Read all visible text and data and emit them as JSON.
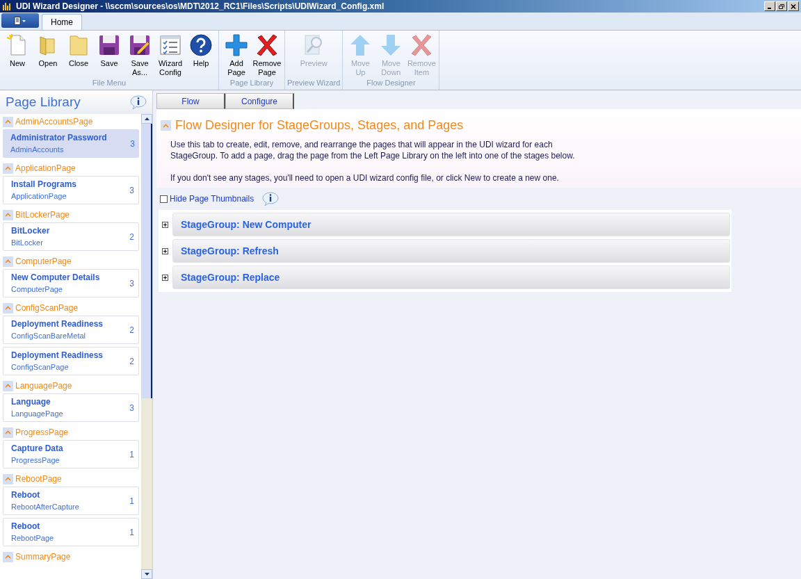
{
  "window": {
    "title": "UDI Wizard Designer - \\\\sccm\\sources\\os\\MDT\\2012_RC1\\Files\\Scripts\\UDIWizard_Config.xml"
  },
  "ribbon": {
    "tabs": [
      {
        "label": "Home",
        "selected": true
      }
    ],
    "groups": [
      {
        "label": "File Menu",
        "buttons": [
          {
            "kind": "new",
            "lines": [
              "New"
            ],
            "disabled": false
          },
          {
            "kind": "open",
            "lines": [
              "Open"
            ],
            "disabled": false
          },
          {
            "kind": "close",
            "lines": [
              "Close"
            ],
            "disabled": false
          },
          {
            "kind": "save",
            "lines": [
              "Save"
            ],
            "disabled": false
          },
          {
            "kind": "saveas",
            "lines": [
              "Save",
              "As..."
            ],
            "disabled": false
          },
          {
            "kind": "config",
            "lines": [
              "Wizard",
              "Config"
            ],
            "disabled": false
          },
          {
            "kind": "help",
            "lines": [
              "Help"
            ],
            "disabled": false
          }
        ]
      },
      {
        "label": "Page Library",
        "buttons": [
          {
            "kind": "add",
            "lines": [
              "Add",
              "Page"
            ],
            "disabled": false
          },
          {
            "kind": "remove",
            "lines": [
              "Remove",
              "Page"
            ],
            "disabled": false
          }
        ]
      },
      {
        "label": "Preview Wizard",
        "buttons": [
          {
            "kind": "preview",
            "lines": [
              "Preview"
            ],
            "disabled": true
          }
        ]
      },
      {
        "label": "Flow Designer",
        "buttons": [
          {
            "kind": "up",
            "lines": [
              "Move",
              "Up"
            ],
            "disabled": true
          },
          {
            "kind": "down",
            "lines": [
              "Move",
              "Down"
            ],
            "disabled": true
          },
          {
            "kind": "remove",
            "lines": [
              "Remove",
              "Item"
            ],
            "disabled": true
          }
        ]
      }
    ]
  },
  "sidebar": {
    "title": "Page Library",
    "groups": [
      {
        "name": "AdminAccountsPage",
        "expanded": true,
        "items": [
          {
            "title": "Administrator Password",
            "subtitle": "AdminAccounts",
            "count": "3",
            "selected": true
          }
        ]
      },
      {
        "name": "ApplicationPage",
        "expanded": true,
        "items": [
          {
            "title": "Install Programs",
            "subtitle": "ApplicationPage",
            "count": "3",
            "selected": false
          }
        ]
      },
      {
        "name": "BitLockerPage",
        "expanded": true,
        "items": [
          {
            "title": "BitLocker",
            "subtitle": "BitLocker",
            "count": "2",
            "selected": false
          }
        ]
      },
      {
        "name": "ComputerPage",
        "expanded": true,
        "items": [
          {
            "title": "New Computer Details",
            "subtitle": "ComputerPage",
            "count": "3",
            "selected": false
          }
        ]
      },
      {
        "name": "ConfigScanPage",
        "expanded": true,
        "items": [
          {
            "title": "Deployment Readiness",
            "subtitle": "ConfigScanBareMetal",
            "count": "2",
            "selected": false
          },
          {
            "title": "Deployment Readiness",
            "subtitle": "ConfigScanPage",
            "count": "2",
            "selected": false
          }
        ]
      },
      {
        "name": "LanguagePage",
        "expanded": true,
        "items": [
          {
            "title": "Language",
            "subtitle": "LanguagePage",
            "count": "3",
            "selected": false
          }
        ]
      },
      {
        "name": "ProgressPage",
        "expanded": true,
        "items": [
          {
            "title": "Capture Data",
            "subtitle": "ProgressPage",
            "count": "1",
            "selected": false
          }
        ]
      },
      {
        "name": "RebootPage",
        "expanded": true,
        "items": [
          {
            "title": "Reboot",
            "subtitle": "RebootAfterCapture",
            "count": "1",
            "selected": false
          },
          {
            "title": "Reboot",
            "subtitle": "RebootPage",
            "count": "1",
            "selected": false
          }
        ]
      },
      {
        "name": "SummaryPage",
        "expanded": true
      }
    ]
  },
  "main": {
    "tabs": [
      {
        "label": "Flow"
      },
      {
        "label": "Configure"
      }
    ],
    "section": {
      "title": "Flow Designer for StageGroups, Stages, and Pages",
      "expanded": true,
      "paragraphs": [
        "Use this tab to create, edit, remove, and rearrange the pages that will appear in the UDI wizard for each StageGroup. To add a page, drag the page from the Left Page Library on the left into one of the stages below.",
        "If you don't see any stages, you'll need to open a UDI wizard config file, or click New to create a new one."
      ]
    },
    "hide_thumbnails": {
      "label": "Hide Page Thumbnails",
      "checked": false
    },
    "stage_groups": [
      {
        "title": "StageGroup: New Computer",
        "expanded": false
      },
      {
        "title": "StageGroup: Refresh",
        "expanded": false
      },
      {
        "title": "StageGroup: Replace",
        "expanded": false
      }
    ]
  }
}
